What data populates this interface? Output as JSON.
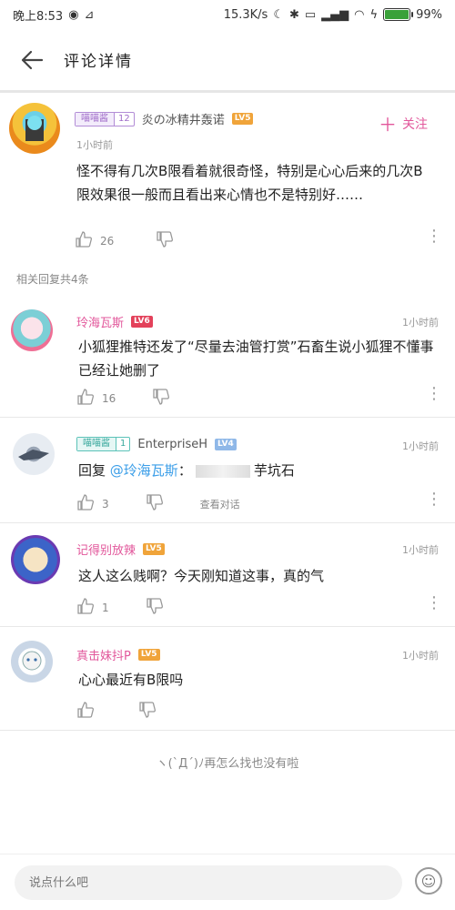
{
  "status_bar": {
    "time": "晚上8:53",
    "speed": "15.3K/s",
    "battery": "99%",
    "battery_level": 0.99
  },
  "header": {
    "back_icon": "back-arrow-icon",
    "title": "评论详情"
  },
  "main_comment": {
    "fan_badge_name": "喵喵酱",
    "fan_badge_level": "12",
    "username": "炎の冰精井轰诺",
    "level": "LV5",
    "time": "1小时前",
    "follow_label": "关注",
    "text": "怪不得有几次B限看着就很奇怪，特别是心心后来的几次B限效果很一般而且看出来心情也不是特别好……",
    "likes": "26"
  },
  "related_label": "相关回复共4条",
  "replies": [
    {
      "username": "玲海瓦斯",
      "level": "LV6",
      "time": "1小时前",
      "text": "小狐狸推特还发了“尽量去油管打赏”石畜生说小狐狸不懂事 已经让她删了",
      "likes": "16"
    },
    {
      "fan_badge_name": "喵喵酱",
      "fan_badge_level": "1",
      "username": "EnterpriseH",
      "level": "LV4",
      "time": "1小时前",
      "reply_prefix": "回复",
      "reply_to": "@玲海瓦斯",
      "reply_colon": "：",
      "reply_suffix": "芋坑石",
      "likes": "3",
      "view_dialog": "查看对话"
    },
    {
      "username": "记得别放辣",
      "level": "LV5",
      "time": "1小时前",
      "text": "这人这么贱啊？今天刚知道这事，真的气",
      "likes": "1"
    },
    {
      "username": "真击妹抖P",
      "level": "LV5",
      "time": "1小时前",
      "text": "心心最近有B限吗",
      "likes": ""
    }
  ],
  "end_text": "ヽ(`Д´)ﾉ再怎么找也没有啦",
  "bottom": {
    "placeholder": "说点什么吧"
  },
  "colors": {
    "pink": "#e2579b",
    "purple": "#a06dc9",
    "link": "#3b9ee8",
    "lv4": "#8fb8e8",
    "lv5": "#f0a43a",
    "lv6": "#e3415a"
  }
}
